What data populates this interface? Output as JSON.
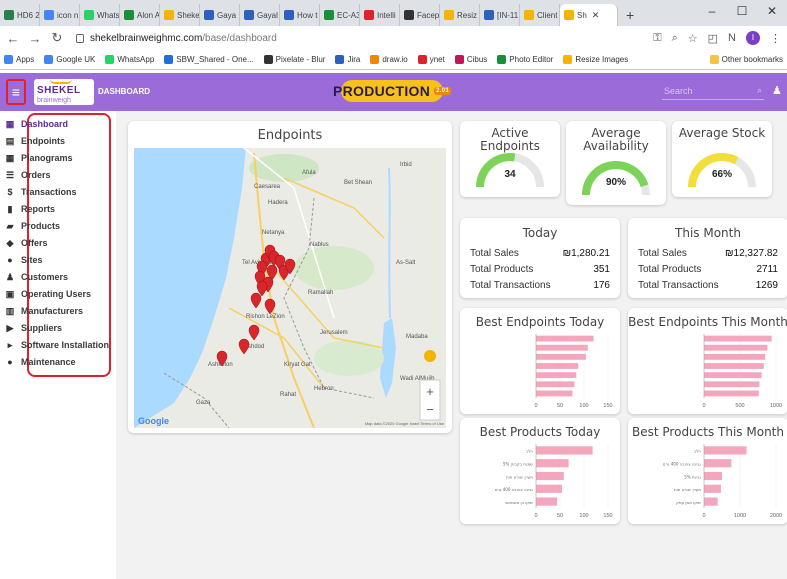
{
  "browser": {
    "tabs": [
      {
        "label": "HD6 2",
        "color": "#2a7d4f"
      },
      {
        "label": "icon n",
        "color": "#4285f4"
      },
      {
        "label": "Whats",
        "color": "#25d366"
      },
      {
        "label": "Alon A",
        "color": "#1a8f3a"
      },
      {
        "label": "Sheke",
        "color": "#f4b400"
      },
      {
        "label": "Gaya",
        "color": "#2d5fbf"
      },
      {
        "label": "Gayal",
        "color": "#2d5fbf"
      },
      {
        "label": "How t",
        "color": "#2d5fbf"
      },
      {
        "label": "EC-A3",
        "color": "#1a8f3a"
      },
      {
        "label": "Intelli",
        "color": "#e0202b"
      },
      {
        "label": "Facep",
        "color": "#333333"
      },
      {
        "label": "Resiz",
        "color": "#f4b400"
      },
      {
        "label": "[IN-11",
        "color": "#2d5fbf"
      },
      {
        "label": "Client",
        "color": "#f4b400"
      },
      {
        "label": "Sh",
        "color": "#f4b400",
        "active": true
      }
    ],
    "new_tab": "+",
    "window_controls": [
      "–",
      "☐",
      "✕"
    ],
    "url_host": "shekelbrainweighmc.com",
    "url_path": "/base/dashboard",
    "profile_initial": "I",
    "bookmarks": [
      {
        "label": "Apps",
        "color": "#4285f4"
      },
      {
        "label": "Google UK",
        "color": "#4285f4"
      },
      {
        "label": "WhatsApp",
        "color": "#25d366"
      },
      {
        "label": "SBW_Shared - One...",
        "color": "#1e6fd9"
      },
      {
        "label": "Pixelate - Blur",
        "color": "#333333"
      },
      {
        "label": "Jira",
        "color": "#2d5fbf"
      },
      {
        "label": "draw.io",
        "color": "#f08705"
      },
      {
        "label": "ynet",
        "color": "#e0202b"
      },
      {
        "label": "Cibus",
        "color": "#c2185b"
      },
      {
        "label": "Photo Editor",
        "color": "#1a8f3a"
      },
      {
        "label": "Resize Images",
        "color": "#f4b400"
      }
    ],
    "other_bookmarks": "Other bookmarks"
  },
  "header": {
    "logo_text": "SHEKEL",
    "logo_sub": "brainweigh",
    "title": "DASHBOARD",
    "env_badge": "PRODUCTION",
    "env_version": "2.01",
    "search_placeholder": "Search",
    "accent": "#9b6cd9"
  },
  "sidebar": {
    "items": [
      {
        "label": "Dashboard",
        "icon": "dashboard-icon",
        "glyph": "▦",
        "active": true
      },
      {
        "label": "Endpoints",
        "icon": "endpoint-icon",
        "glyph": "▤"
      },
      {
        "label": "Planograms",
        "icon": "grid-icon",
        "glyph": "▦"
      },
      {
        "label": "Orders",
        "icon": "list-icon",
        "glyph": "☰"
      },
      {
        "label": "Transactions",
        "icon": "dollar-icon",
        "glyph": "$"
      },
      {
        "label": "Reports",
        "icon": "bar-chart-icon",
        "glyph": "▮"
      },
      {
        "label": "Products",
        "icon": "truck-icon",
        "glyph": "▰"
      },
      {
        "label": "Offers",
        "icon": "tag-icon",
        "glyph": "◆"
      },
      {
        "label": "Sites",
        "icon": "map-pin-icon",
        "glyph": "●"
      },
      {
        "label": "Customers",
        "icon": "users-icon",
        "glyph": "♟"
      },
      {
        "label": "Operating Users",
        "icon": "id-card-icon",
        "glyph": "▣"
      },
      {
        "label": "Manufacturers",
        "icon": "factory-icon",
        "glyph": "▥"
      },
      {
        "label": "Suppliers",
        "icon": "truck-icon",
        "glyph": "▶"
      },
      {
        "label": "Software Installation",
        "icon": "caret-right-icon",
        "glyph": "▸"
      },
      {
        "label": "Maintenance",
        "icon": "info-icon",
        "glyph": "●"
      }
    ]
  },
  "map": {
    "title": "Endpoints",
    "labels": [
      "Netanya",
      "Hadera",
      "Tel Aviv-Yafo",
      "Rishon LeZion",
      "Ashdod",
      "Ashkelon",
      "Gaza",
      "Jerusalem",
      "Nablus",
      "Ramallah",
      "Hebron",
      "Bet Shean",
      "Irbid",
      "Afula",
      "Caesarea",
      "Kiryat Gat",
      "Rahat",
      "Madaba",
      "As-Salt",
      "Wadi AlMujib"
    ],
    "pin_color": "#d9262b",
    "google": "Google",
    "footer": "Map data ©2020 Google Israel  Terms of Use"
  },
  "kpis": [
    {
      "title": "Active Endpoints",
      "value": "34",
      "fraction": 0.55,
      "color": "#7dd35a"
    },
    {
      "title": "Average Availability",
      "value": "90%",
      "fraction": 0.9,
      "color": "#7dd35a"
    },
    {
      "title": "Average Stock",
      "value": "66%",
      "fraction": 0.66,
      "color": "#f2de3b"
    }
  ],
  "today": {
    "title": "Today",
    "rows": [
      {
        "label": "Total Sales",
        "value": "₪1,280.21"
      },
      {
        "label": "Total Products",
        "value": "351"
      },
      {
        "label": "Total Transactions",
        "value": "176"
      }
    ]
  },
  "this_month": {
    "title": "This Month",
    "rows": [
      {
        "label": "Total Sales",
        "value": "₪12,327.82"
      },
      {
        "label": "Total Products",
        "value": "2711"
      },
      {
        "label": "Total Transactions",
        "value": "1269"
      }
    ]
  },
  "chart_data": [
    {
      "type": "bar",
      "title": "Best Endpoints Today",
      "orientation": "horizontal",
      "categories": [
        "",
        "",
        "",
        "",
        "",
        "",
        ""
      ],
      "values": [
        120,
        108,
        104,
        88,
        84,
        80,
        76
      ],
      "xlim": [
        0,
        150
      ],
      "xticks": [
        "0",
        "50",
        "100",
        "150"
      ],
      "color": "#f4a6bd"
    },
    {
      "type": "bar",
      "title": "Best Endpoints This Month",
      "orientation": "horizontal",
      "categories": [
        "",
        "",
        "",
        "",
        "",
        "",
        ""
      ],
      "values": [
        940,
        880,
        850,
        830,
        800,
        770,
        760
      ],
      "xlim": [
        0,
        1000
      ],
      "xticks": [
        "0",
        "500",
        "1000"
      ],
      "color": "#f4a6bd"
    },
    {
      "type": "bar",
      "title": "Best Products Today",
      "orientation": "horizontal",
      "categories": [
        "חלב",
        "5% שמנת בקבוק",
        "מעדן יוגורט תות",
        "גבינה צהובה 400 גרם",
        "שוקו בן אשמאש"
      ],
      "values": [
        118,
        68,
        58,
        54,
        44
      ],
      "xlim": [
        0,
        150
      ],
      "xticks": [
        "0",
        "50",
        "100",
        "150"
      ],
      "color": "#f4a6bd"
    },
    {
      "type": "bar",
      "title": "Best Products This Month",
      "orientation": "horizontal",
      "categories": [
        "חלב",
        "גבינה צהובה 400 גרם",
        "5% גבינת",
        "מעדן יוגורט תות",
        "שוקו אמן עמק"
      ],
      "values": [
        1180,
        760,
        500,
        470,
        380
      ],
      "xlim": [
        0,
        2000
      ],
      "xticks": [
        "0",
        "1000",
        "2000"
      ],
      "color": "#f4a6bd"
    }
  ]
}
